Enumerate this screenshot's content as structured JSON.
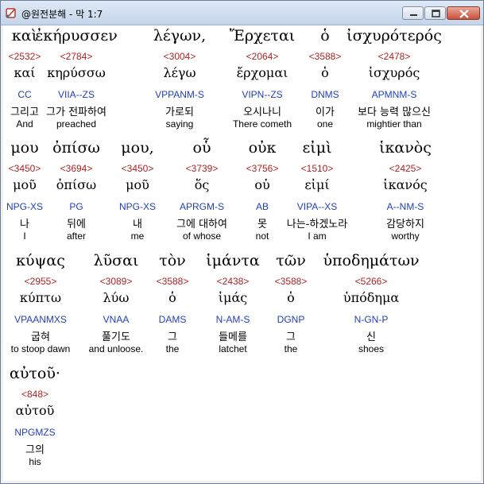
{
  "window": {
    "title": "@원전분해 - 막 1:7",
    "icon": "scroll-quill-icon",
    "controls": {
      "minimize": "minimize-icon",
      "maximize": "maximize-icon",
      "close": "close-icon"
    }
  },
  "colors": {
    "strong": "#b22222",
    "parsing": "#1f3fbf",
    "text": "#000000"
  },
  "rows": [
    {
      "greek": [
        "καὶ",
        "ἐκήρυσσεν",
        "λέγων,",
        "Ἔρχεται",
        "ὁ",
        "ἰσχυρότερός"
      ],
      "strong": [
        "<2532>",
        "<2784>",
        "<3004>",
        "<2064>",
        "<3588>",
        "<2478>"
      ],
      "lemma": [
        "καί",
        "κηρύσσω",
        "λέγω",
        "ἔρχομαι",
        "ὁ",
        "ἰσχυρός"
      ],
      "parsing": [
        "CC",
        "VIIA--ZS",
        "VPPANM-S",
        "VIPN--ZS",
        "DNMS",
        "APMNM-S"
      ],
      "korean": [
        "그리고",
        "그가 전파하여",
        "가로되",
        "오시나니",
        "이가",
        "보다 능력 많으신"
      ],
      "english": [
        "And",
        "preached",
        "saying",
        "There cometh",
        "one",
        "mightier than"
      ]
    },
    {
      "greek": [
        "μου",
        "ὀπίσω",
        "μου,",
        "οὗ",
        "οὐκ",
        "εἰμὶ",
        "ἱκανὸς"
      ],
      "strong": [
        "<3450>",
        "<3694>",
        "<3450>",
        "<3739>",
        "<3756>",
        "<1510>",
        "<2425>"
      ],
      "lemma": [
        "μοῦ",
        "ὀπίσω",
        "μοῦ",
        "ὅς",
        "οὐ",
        "εἰμί",
        "ἱκανός"
      ],
      "parsing": [
        "NPG-XS",
        "PG",
        "NPG-XS",
        "APRGM-S",
        "AB",
        "VIPA--XS",
        "A--NM-S"
      ],
      "korean": [
        "나",
        "뒤에",
        "내",
        "그에 대하여",
        "못",
        "나는-하겠노라",
        "감당하지"
      ],
      "english": [
        "I",
        "after",
        "me",
        "of whose",
        "not",
        "I am",
        "worthy"
      ]
    },
    {
      "greek": [
        "κύψας",
        "λῦσαι",
        "τὸν",
        "ἱμάντα",
        "τῶν",
        "ὑποδημάτων"
      ],
      "strong": [
        "<2955>",
        "<3089>",
        "<3588>",
        "<2438>",
        "<3588>",
        "<5266>"
      ],
      "lemma": [
        "κύπτω",
        "λύω",
        "ὁ",
        "ἱμάς",
        "ὁ",
        "ὑπόδημα"
      ],
      "parsing": [
        "VPAANMXS",
        "VNAA",
        "DAMS",
        "N-AM-S",
        "DGNP",
        "N-GN-P"
      ],
      "korean": [
        "굽혀",
        "풀기도",
        "그",
        "들메를",
        "그",
        "신"
      ],
      "english": [
        "to stoop dawn",
        "and unloose.",
        "the",
        "latchet",
        "the",
        "shoes"
      ]
    },
    {
      "greek": [
        "αὐτοῦ·"
      ],
      "strong": [
        "<848>"
      ],
      "lemma": [
        "αὐτοῦ"
      ],
      "parsing": [
        "NPGMZS"
      ],
      "korean": [
        "그의"
      ],
      "english": [
        "his"
      ]
    }
  ]
}
